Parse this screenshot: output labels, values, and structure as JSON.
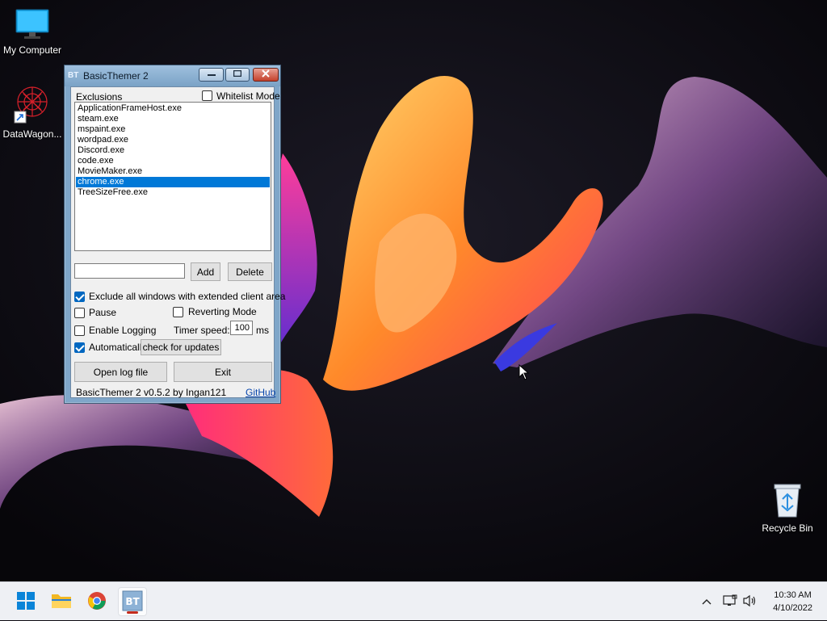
{
  "desktop": {
    "icons": [
      {
        "label": "My Computer",
        "icon": "monitor-icon"
      },
      {
        "label": "DataWagon...",
        "icon": "datawagon-icon"
      },
      {
        "label": "Recycle Bin",
        "icon": "recycle-bin-icon"
      }
    ]
  },
  "window": {
    "app_icon": "BT",
    "title": "BasicThemer 2",
    "exclusions_label": "Exclusions",
    "whitelist_label": "Whitelist Mode",
    "whitelist_checked": false,
    "exclusions": [
      "ApplicationFrameHost.exe",
      "steam.exe",
      "mspaint.exe",
      "wordpad.exe",
      "Discord.exe",
      "code.exe",
      "MovieMaker.exe",
      "chrome.exe",
      "TreeSizeFree.exe"
    ],
    "selected_exclusion": "chrome.exe",
    "new_entry_value": "",
    "add_label": "Add",
    "delete_label": "Delete",
    "exclude_extended_label": "Exclude all windows with extended client area",
    "exclude_extended_checked": true,
    "pause_label": "Pause",
    "pause_checked": false,
    "reverting_label": "Reverting Mode",
    "reverting_checked": false,
    "logging_label": "Enable Logging",
    "logging_checked": false,
    "timer_label": "Timer speed:",
    "timer_value": "100",
    "timer_unit": "ms",
    "auto_label": "Automatically",
    "auto_checked": true,
    "check_updates_label": "check for updates",
    "open_log_label": "Open log file",
    "exit_label": "Exit",
    "version_text": "BasicThemer 2 v0.5.2 by Ingan121",
    "github_label": "GitHub"
  },
  "taskbar": {
    "items": [
      {
        "name": "start",
        "icon": "windows-logo-icon"
      },
      {
        "name": "file-explorer",
        "icon": "folder-icon"
      },
      {
        "name": "chrome",
        "icon": "chrome-icon"
      },
      {
        "name": "basicthemer",
        "icon": "basicthemer-icon",
        "active": true
      }
    ],
    "time": "10:30 AM",
    "date": "4/10/2022"
  }
}
